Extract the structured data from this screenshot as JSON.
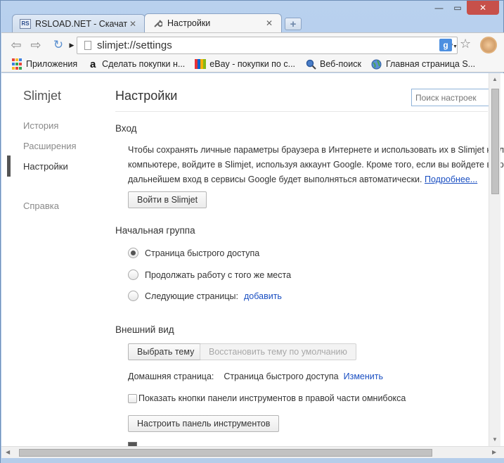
{
  "tabs": [
    {
      "title": "RSLOAD.NET - Скачать со",
      "favicon": "RS"
    },
    {
      "title": "Настройки",
      "favicon": "wrench-icon"
    }
  ],
  "toolbar": {
    "url": "slimjet://settings",
    "search_engine_badge": "g"
  },
  "bookmarks": [
    {
      "label": "Приложения",
      "icon": "apps-icon"
    },
    {
      "label": "Сделать покупки н...",
      "icon": "a"
    },
    {
      "label": "eBay - покупки по с...",
      "icon": "ebay-icon"
    },
    {
      "label": "Веб-поиск",
      "icon": "search-icon"
    },
    {
      "label": "Главная страница S...",
      "icon": "globe-icon"
    }
  ],
  "sidebar": {
    "brand": "Slimjet",
    "items": [
      {
        "label": "История"
      },
      {
        "label": "Расширения"
      },
      {
        "label": "Настройки"
      },
      {
        "label": "Справка"
      }
    ]
  },
  "main": {
    "title": "Настройки",
    "search_placeholder": "Поиск настроек",
    "signin": {
      "heading": "Вход",
      "line1": "Чтобы сохранять личные параметры браузера в Интернете и использовать их в Slimjet на лю",
      "line2": "компьютере, войдите в Slimjet, используя аккаунт Google. Кроме того, если вы войдете в бра",
      "line3": "дальнейшем вход в сервисы Google будет выполняться автоматически.",
      "more_link": "Подробнее...",
      "button": "Войти в Slimjet"
    },
    "startup": {
      "heading": "Начальная группа",
      "options": [
        {
          "label": "Страница быстрого доступа",
          "checked": true
        },
        {
          "label": "Продолжать работу с того же места",
          "checked": false
        },
        {
          "label": "Следующие страницы:",
          "checked": false
        }
      ],
      "add_link": "добавить"
    },
    "appearance": {
      "heading": "Внешний вид",
      "choose_theme": "Выбрать тему",
      "reset_theme": "Восстановить тему по умолчанию",
      "home_label": "Домашняя страница:",
      "home_value": "Страница быстрого доступа",
      "home_change": "Изменить",
      "show_buttons": "Показать кнопки панели инструментов в правой части омнибокса",
      "customize_toolbar": "Настроить панель инструментов"
    }
  }
}
